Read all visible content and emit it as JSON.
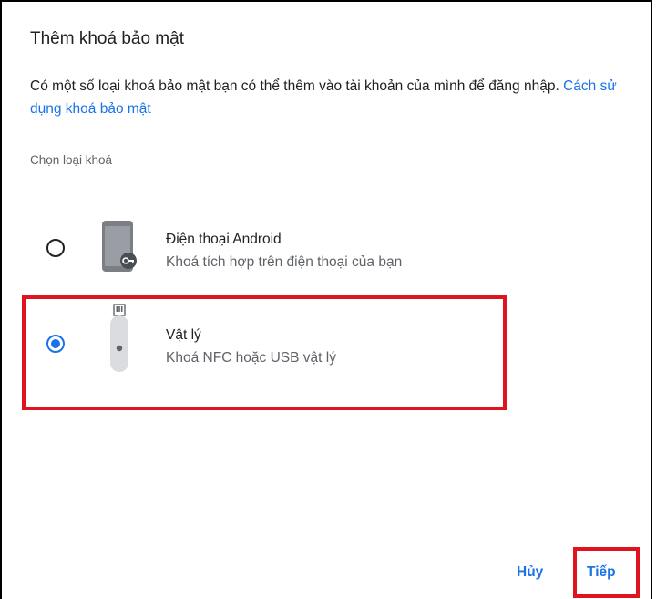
{
  "dialog": {
    "title": "Thêm khoá bảo mật",
    "description": "Có một số loại khoá bảo mật bạn có thể thêm vào tài khoản của mình để đăng nhập.",
    "help_link": "Cách sử dụng khoá bảo mật",
    "section_label": "Chọn loại khoá"
  },
  "options": [
    {
      "title": "Điện thoại Android",
      "subtitle": "Khoá tích hợp trên điện thoại của bạn",
      "icon": "android-phone-key-icon",
      "selected": false
    },
    {
      "title": "Vật lý",
      "subtitle": "Khoá NFC hoặc USB vật lý",
      "icon": "usb-security-key-icon",
      "selected": true
    }
  ],
  "buttons": {
    "cancel": "Hủy",
    "next": "Tiếp"
  },
  "colors": {
    "accent": "#1a73e8",
    "highlight": "#e0141e"
  }
}
